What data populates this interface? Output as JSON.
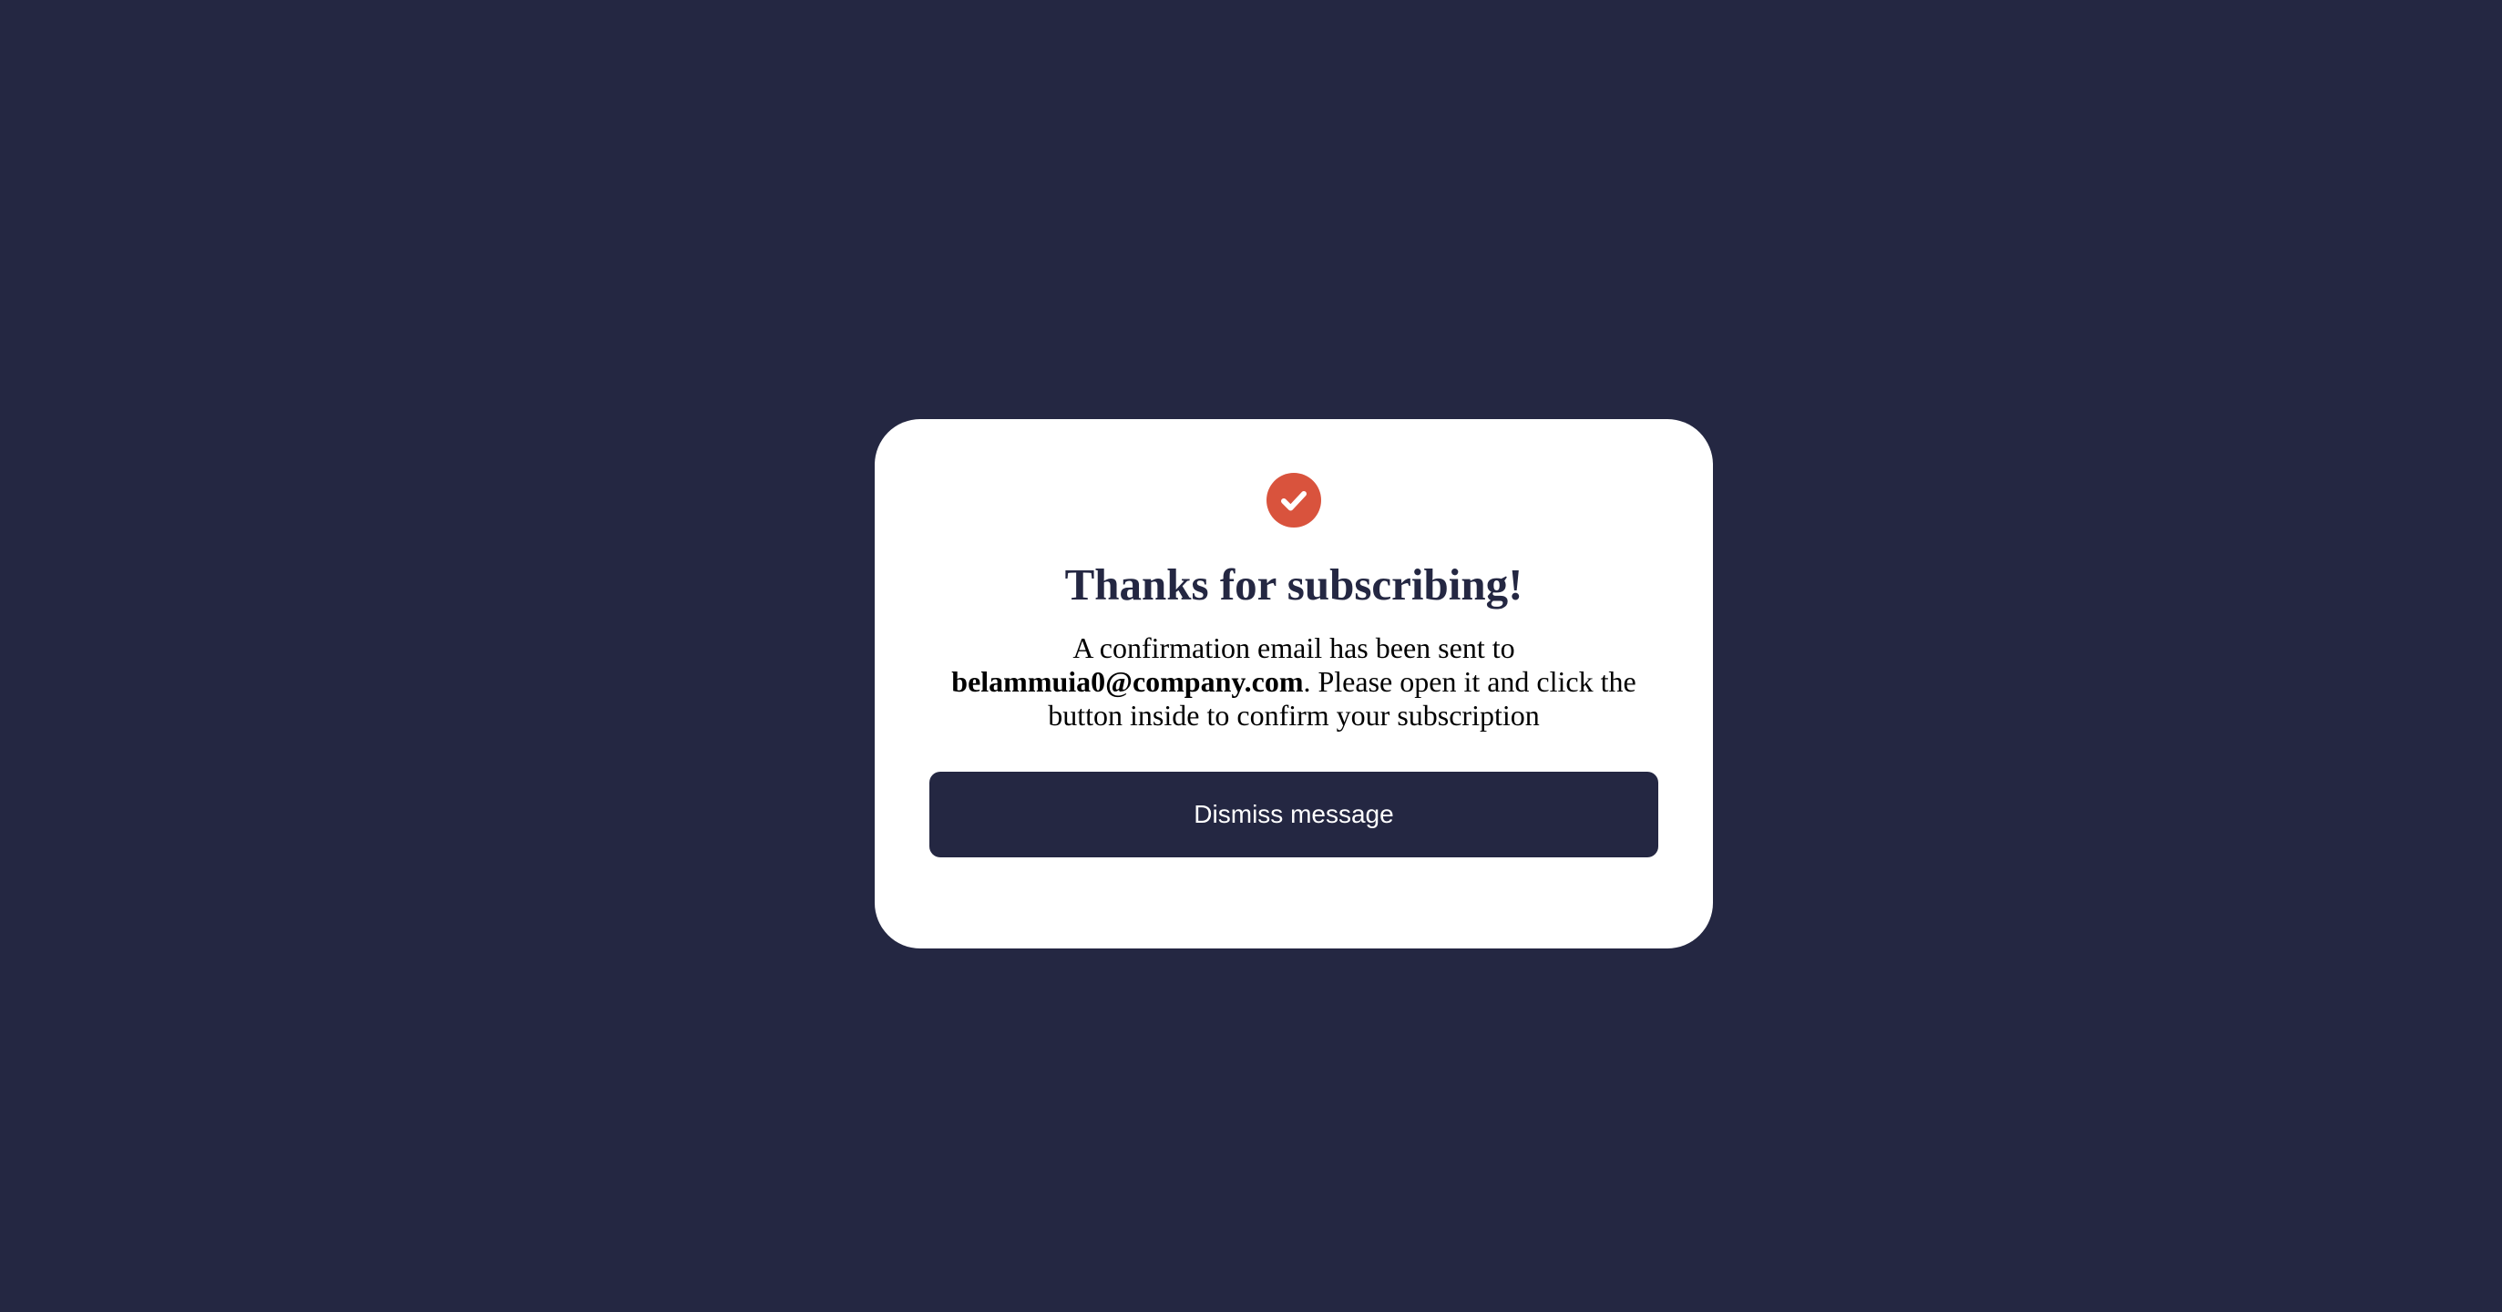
{
  "colors": {
    "page_background": "#242742",
    "card_background": "#ffffff",
    "accent": "#d9533d",
    "heading": "#242742",
    "button_background": "#242742",
    "button_text": "#ffffff"
  },
  "dialog": {
    "icon": "check-circle-icon",
    "title": "Thanks for subscribing!",
    "message_prefix": "A confirmation email has been sent to ",
    "email": "belammuia0@company.com",
    "message_suffix": ". Please open it and click the button inside to confirm your subscription",
    "dismiss_label": "Dismiss message"
  }
}
